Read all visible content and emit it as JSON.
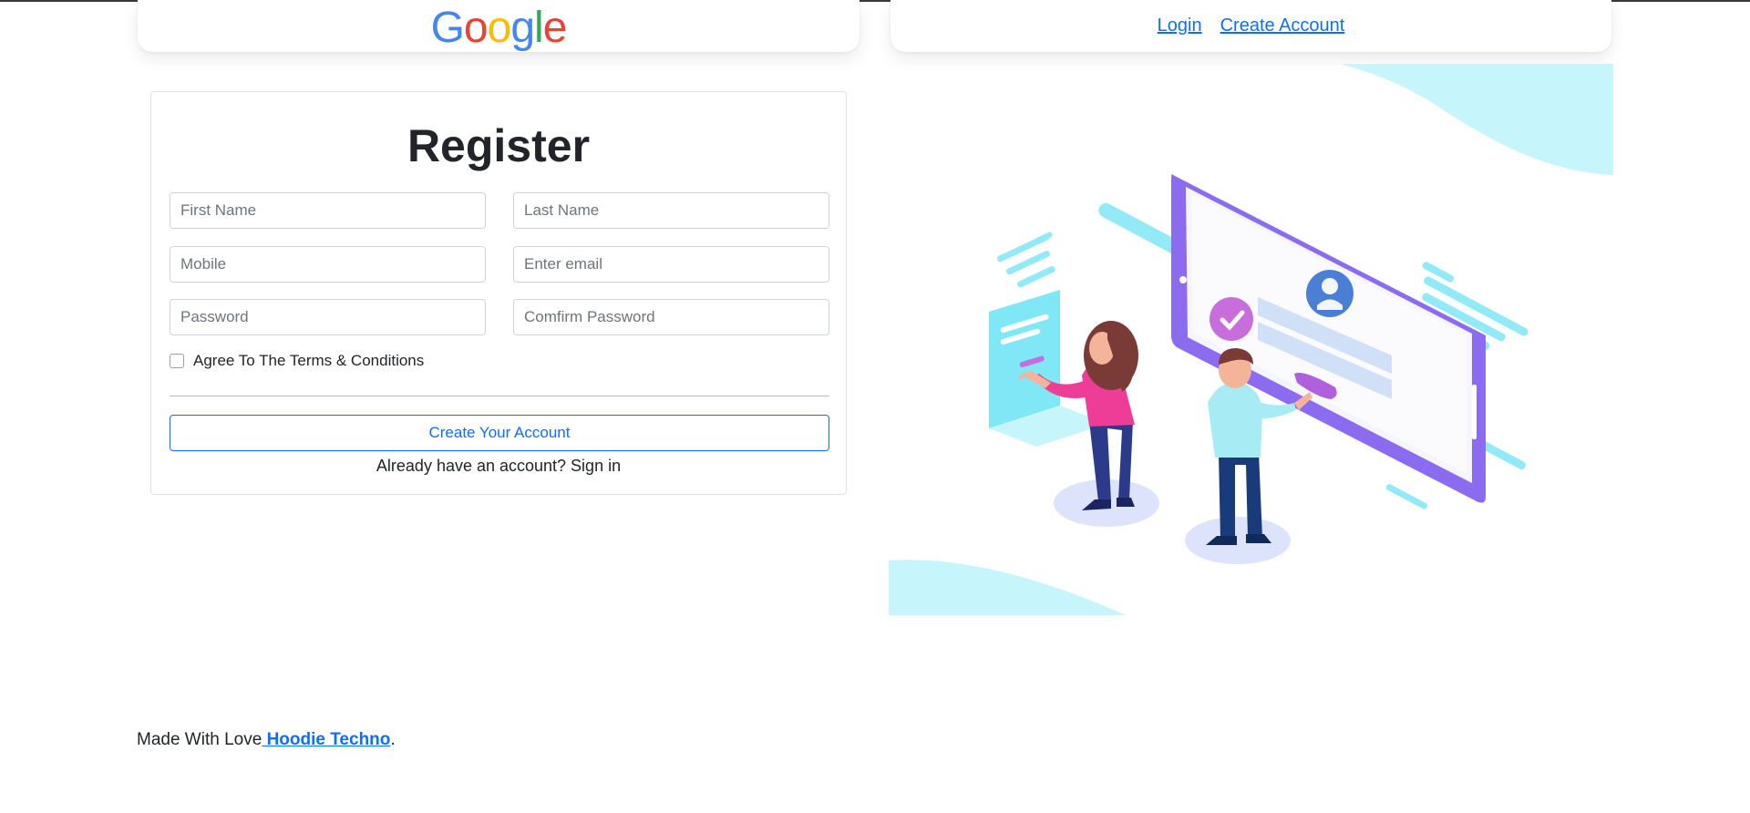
{
  "header": {
    "logo_text": "Google",
    "nav": {
      "login": "Login",
      "create_account": "Create Account"
    }
  },
  "form": {
    "title": "Register",
    "fields": {
      "first_name": {
        "placeholder": "First Name",
        "value": ""
      },
      "last_name": {
        "placeholder": "Last Name",
        "value": ""
      },
      "mobile": {
        "placeholder": "Mobile",
        "value": ""
      },
      "email": {
        "placeholder": "Enter email",
        "value": ""
      },
      "password": {
        "placeholder": "Password",
        "value": ""
      },
      "confirm_password": {
        "placeholder": "Comfirm Password",
        "value": ""
      }
    },
    "terms_label": "Agree To The Terms & Conditions",
    "terms_checked": false,
    "submit_label": "Create Your Account",
    "signin_text": "Already have an account? Sign in"
  },
  "footer": {
    "prefix": "Made With Love",
    "link": " Hoodie Techno",
    "suffix": "."
  },
  "colors": {
    "link_blue": "#0d6efd",
    "google_blue": "#4285F4",
    "google_red": "#EA4335",
    "google_yellow": "#FBBC05",
    "google_green": "#34A853",
    "illustration_cyan": "#c6f6fb",
    "illustration_purple": "#8b6cf0",
    "illustration_pink": "#ee3d97"
  },
  "icons": {
    "illustration": "registration-illustration",
    "checkbox": "checkbox-icon"
  }
}
